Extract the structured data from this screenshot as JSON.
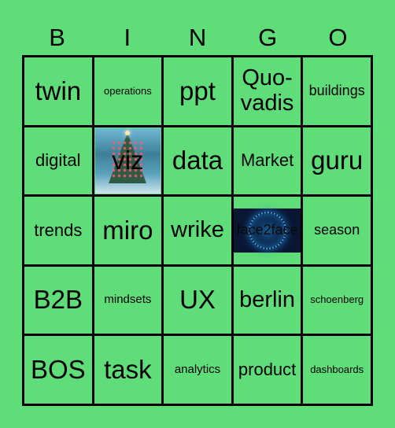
{
  "header": [
    "B",
    "I",
    "N",
    "G",
    "O"
  ],
  "colors": {
    "background": "#5edd78",
    "grid_lines": "#000000"
  },
  "cells": [
    {
      "text": "twin",
      "size": "xl"
    },
    {
      "text": "operations",
      "size": "xxs"
    },
    {
      "text": "ppt",
      "size": "xl"
    },
    {
      "text": "Quo-vadis",
      "size": "l"
    },
    {
      "text": "buildings",
      "size": "s"
    },
    {
      "text": "digital",
      "size": "m"
    },
    {
      "text": "viz",
      "size": "xl",
      "image": "christmas-tree-image"
    },
    {
      "text": "data",
      "size": "xl"
    },
    {
      "text": "Market",
      "size": "m"
    },
    {
      "text": "guru",
      "size": "xl"
    },
    {
      "text": "trends",
      "size": "m"
    },
    {
      "text": "miro",
      "size": "xl"
    },
    {
      "text": "wrike",
      "size": "l"
    },
    {
      "text": "face2face",
      "size": "s",
      "image": "digital-globe-image"
    },
    {
      "text": "season",
      "size": "s"
    },
    {
      "text": "B2B",
      "size": "xl"
    },
    {
      "text": "mindsets",
      "size": "xs"
    },
    {
      "text": "UX",
      "size": "xl"
    },
    {
      "text": "berlin",
      "size": "l"
    },
    {
      "text": "schoenberg",
      "size": "xxs"
    },
    {
      "text": "BOS",
      "size": "xl"
    },
    {
      "text": "task",
      "size": "xl"
    },
    {
      "text": "analytics",
      "size": "xs"
    },
    {
      "text": "product",
      "size": "m"
    },
    {
      "text": "dashboards",
      "size": "xxs"
    }
  ]
}
